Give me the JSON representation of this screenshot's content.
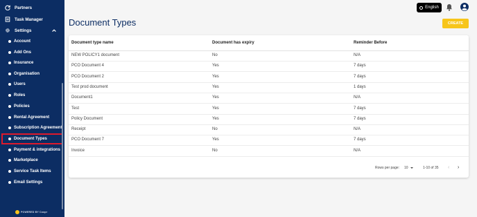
{
  "sidebar": {
    "top_items": [
      {
        "label": "Partners",
        "icon": "refresh-icon"
      },
      {
        "label": "Task Manager",
        "icon": "task-icon"
      },
      {
        "label": "Settings",
        "icon": "gear-icon"
      }
    ],
    "settings_items": [
      "Account",
      "Add Ons",
      "Insurance",
      "Organisation",
      "Users",
      "Roles",
      "Policies",
      "Rental Agreement",
      "Subscription Agreement",
      "Document Types",
      "Payment & integrations",
      "Marketplace",
      "Service Task Items",
      "Email Settings"
    ],
    "active_item": "Document Types",
    "powered_by": "POWERED BY Coopr"
  },
  "header": {
    "language": "English",
    "title": "Document Types",
    "create_label": "CREATE"
  },
  "table": {
    "columns": [
      "Document type name",
      "Document has expiry",
      "Reminder Before"
    ],
    "rows": [
      [
        "NEW POLICY1 document",
        "No",
        "N/A"
      ],
      [
        "PCO Document 4",
        "Yes",
        "7 days"
      ],
      [
        "PCO Document 2",
        "Yes",
        "7 days"
      ],
      [
        "Test prod document",
        "Yes",
        "1 days"
      ],
      [
        "Document1",
        "Yes",
        "N/A"
      ],
      [
        "Test",
        "Yes",
        "7 days"
      ],
      [
        "Policy Document",
        "Yes",
        "7 days"
      ],
      [
        "Receipt",
        "No",
        "N/A"
      ],
      [
        "PCO Document 7",
        "Yes",
        "7 days"
      ],
      [
        "Invoice",
        "No",
        "N/A"
      ]
    ]
  },
  "pagination": {
    "rows_per_page_label": "Rows per page:",
    "rows_per_page": "10",
    "range": "1-10 of 35"
  },
  "colors": {
    "sidebar": "#0c2d63",
    "accent": "#f7c51a",
    "active_outline": "#e0192b"
  }
}
